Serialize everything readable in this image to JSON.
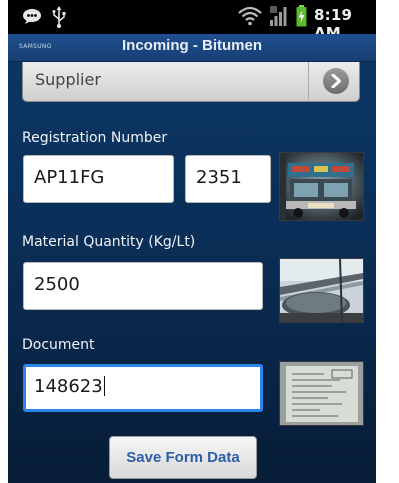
{
  "status_bar": {
    "time": "8:19 AM",
    "icons": [
      "talk-icon",
      "usb-icon",
      "wifi-icon",
      "signal-icon",
      "battery-charging-icon"
    ]
  },
  "title_bar": {
    "app_icon_text": "SAMSUNG",
    "title": "Incoming - Bitumen",
    "color": "#1f4f8f"
  },
  "form": {
    "supplier": {
      "selected_value": "Supplier",
      "arrow_icon": "chevron-right-icon"
    },
    "registration": {
      "label": "Registration Number",
      "prefix_value": "AP11FG",
      "number_value": "2351",
      "photo": "truck-photo-thumbnail"
    },
    "quantity": {
      "label": "Material Quantity (Kg/Lt)",
      "value": "2500",
      "photo": "tanker-photo-thumbnail"
    },
    "document": {
      "label": "Document",
      "value": "148623",
      "photo": "document-photo-thumbnail",
      "focus_color": "#2b86ee"
    },
    "save_label": "Save Form Data"
  }
}
